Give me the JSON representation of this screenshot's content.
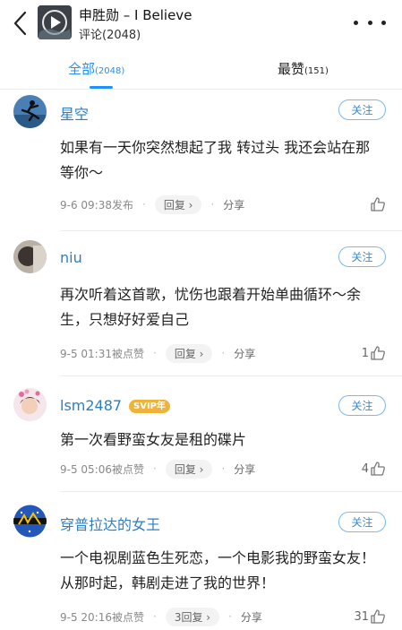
{
  "header": {
    "title": "申胜勋 – I Believe",
    "subtitle": "评论(2048)"
  },
  "tabs": {
    "all": {
      "label": "全部",
      "count": "(2048)"
    },
    "hot": {
      "label": "最赞",
      "count": "(151)"
    }
  },
  "comments": [
    {
      "username": "星空",
      "follow": "关注",
      "text": "如果有一天你突然想起了我 转过头 我还会站在那 等你～",
      "time": "9-6 09:38发布",
      "reply": "回复 ›",
      "share": "分享",
      "likes": ""
    },
    {
      "username": "niu",
      "follow": "关注",
      "text": "再次听着这首歌，忧伤也跟着开始单曲循环～余生，只想好好爱自己",
      "time": "9-5 01:31被点赞",
      "reply": "回复 ›",
      "share": "分享",
      "likes": "1"
    },
    {
      "username": "lsm2487",
      "badge": "SVIP年",
      "follow": "关注",
      "text": "第一次看野蛮女友是租的碟片",
      "time": "9-5 05:06被点赞",
      "reply": "回复 ›",
      "share": "分享",
      "likes": "4"
    },
    {
      "username": "穿普拉达的女王",
      "follow": "关注",
      "text": "一个电视剧蓝色生死恋，一个电影我的野蛮女友！从那时起，韩剧走进了我的世界！",
      "time": "9-5 20:16被点赞",
      "reply": "3回复 ›",
      "share": "分享",
      "likes": "31"
    }
  ]
}
